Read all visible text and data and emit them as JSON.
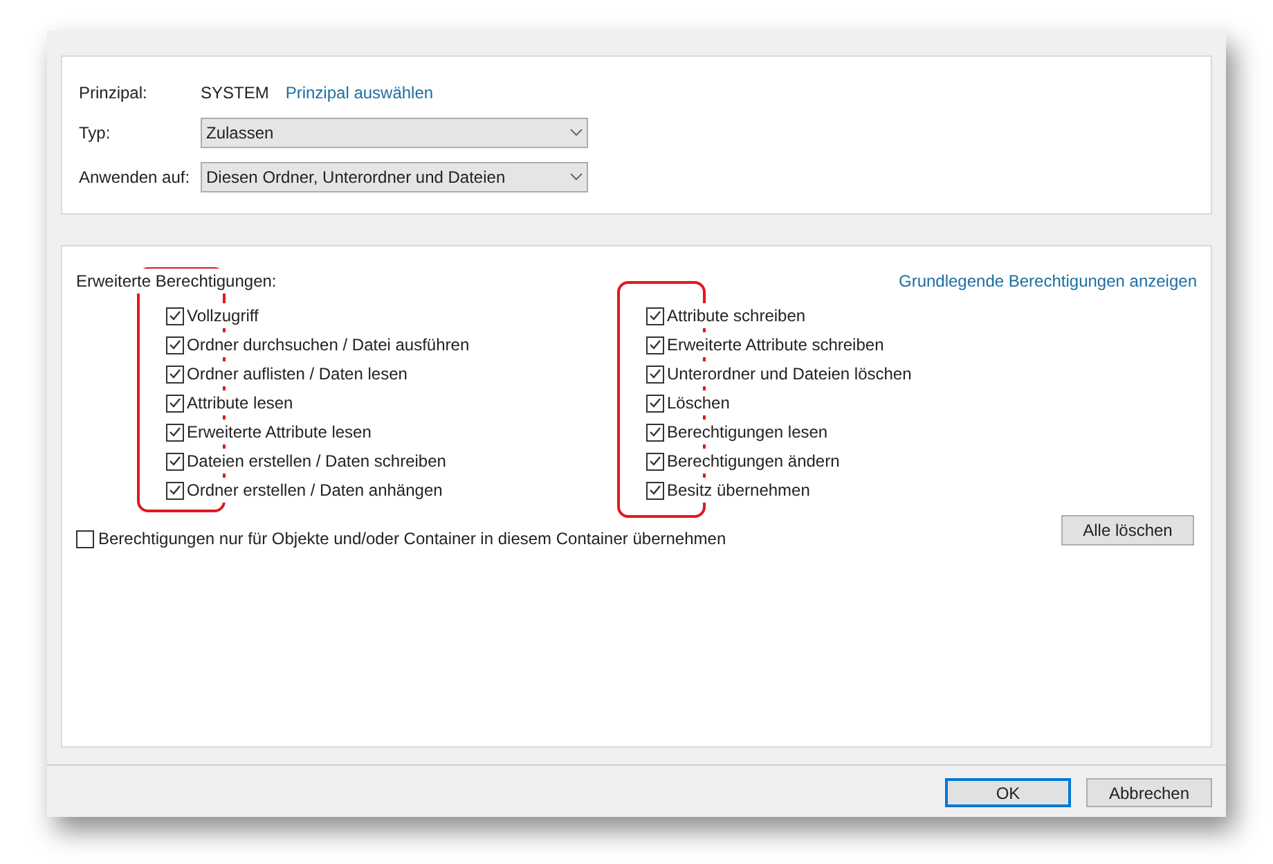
{
  "principal": {
    "label": "Prinzipal:",
    "value": "SYSTEM",
    "link": "Prinzipal auswählen"
  },
  "fields": [
    {
      "label": "Typ:",
      "value": "Zulassen"
    },
    {
      "label": "Anwenden auf:",
      "value": "Diesen Ordner, Unterordner und Dateien"
    }
  ],
  "permissions": {
    "title": "Erweiterte Berechtigungen:",
    "link": "Grundlegende Berechtigungen anzeigen",
    "columns": [
      {
        "highlighted": true,
        "items": [
          {
            "label": "Vollzugriff",
            "checked": true
          },
          {
            "label": "Ordner durchsuchen / Datei ausführen",
            "checked": true
          },
          {
            "label": "Ordner auflisten / Daten lesen",
            "checked": true
          },
          {
            "label": "Attribute lesen",
            "checked": true
          },
          {
            "label": "Erweiterte Attribute lesen",
            "checked": true
          },
          {
            "label": "Dateien erstellen / Daten schreiben",
            "checked": true
          },
          {
            "label": "Ordner erstellen / Daten anhängen",
            "checked": true
          }
        ]
      },
      {
        "highlighted": true,
        "items": [
          {
            "label": "Attribute schreiben",
            "checked": true
          },
          {
            "label": "Erweiterte Attribute schreiben",
            "checked": true
          },
          {
            "label": "Unterordner und Dateien löschen",
            "checked": true
          },
          {
            "label": "Löschen",
            "checked": true
          },
          {
            "label": "Berechtigungen lesen",
            "checked": true
          },
          {
            "label": "Berechtigungen ändern",
            "checked": true
          },
          {
            "label": "Besitz übernehmen",
            "checked": true
          }
        ]
      }
    ],
    "inherit_only": {
      "label": "Berechtigungen nur für Objekte und/oder Container in diesem Container übernehmen",
      "checked": false
    },
    "clear_button": "Alle löschen"
  },
  "buttons": [
    {
      "label": "OK",
      "selected": true
    },
    {
      "label": "Abbrechen",
      "selected": false
    }
  ]
}
